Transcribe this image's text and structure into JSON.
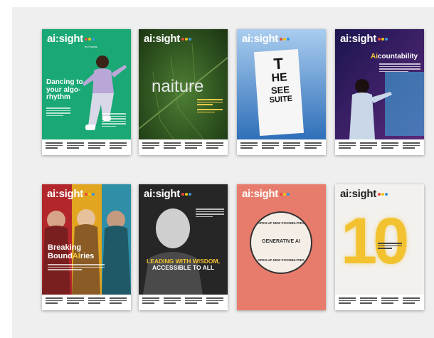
{
  "logo": {
    "text": "ai:sight",
    "byline": "by Fractal",
    "dots": [
      "#e74c3c",
      "#f1c40f",
      "#3498db"
    ]
  },
  "covers": [
    {
      "id": "c1",
      "headline": "Dancing to your algo-rhythm",
      "bg": "#1aa874"
    },
    {
      "id": "c2",
      "headline": "naiture",
      "bg": "#2f5a22"
    },
    {
      "id": "c3",
      "chart_lines": [
        "T",
        "HE",
        "SEE",
        "SUITE"
      ],
      "bg": "#5b9ad6"
    },
    {
      "id": "c4",
      "headline_prefix": "Ai",
      "headline_suffix": "countability",
      "bg": "#2b1e5c"
    },
    {
      "id": "c5",
      "headline_line1": "Breaking",
      "headline_line2_a": "Bound",
      "headline_line2_b": "AI",
      "headline_line2_c": "ries",
      "bg": "#c0392b"
    },
    {
      "id": "c6",
      "headline_line1": "LEADING WITH WISDOM,",
      "headline_line2": "ACCESSIBLE TO ALL",
      "bg": "#2c2c2c"
    },
    {
      "id": "c7",
      "ring_top": "OPEN UP NEW POSSIBILITIES",
      "ring_center": "GENERATIVE AI",
      "ring_bottom": "OPEN UP NEW POSSIBILITIES",
      "bg": "#e87c6c"
    },
    {
      "id": "c8",
      "big_number": "10",
      "bg": "#f3f1ee"
    }
  ]
}
